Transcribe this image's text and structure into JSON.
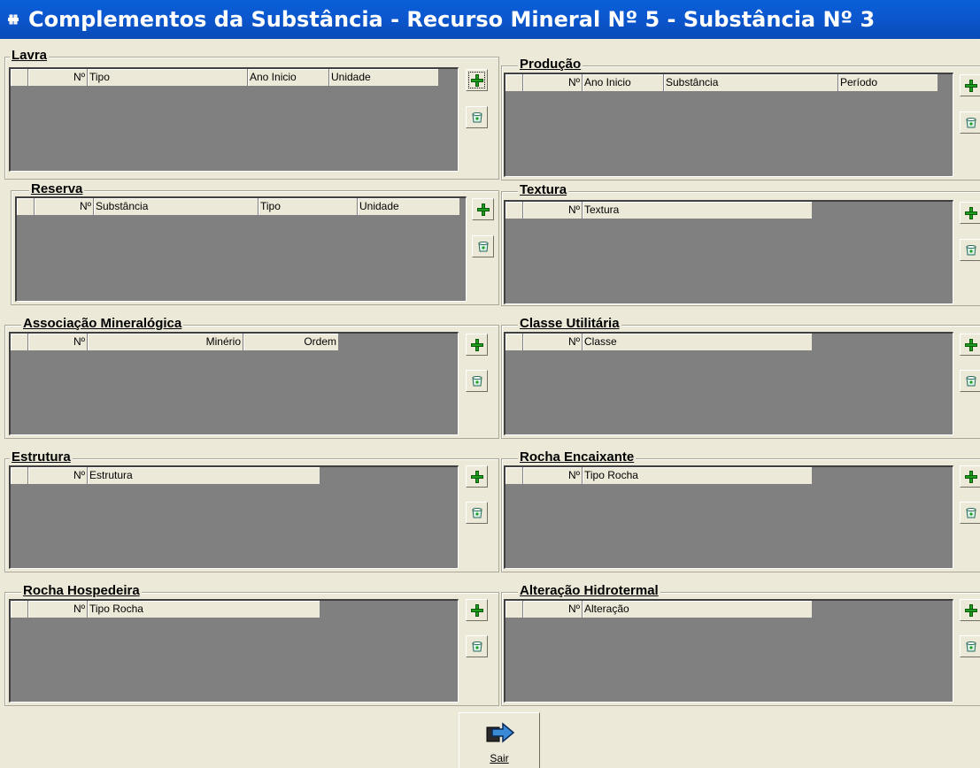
{
  "window": {
    "title": "Complementos da Substância - Recurso Mineral Nº 5 - Substância Nº 3"
  },
  "groups": {
    "lavra": {
      "title": "Lavra",
      "columns": [
        "",
        "Nº",
        "Tipo",
        "Ano Inicio",
        "Unidade"
      ]
    },
    "producao": {
      "title": "Produção",
      "columns": [
        "",
        "Nº",
        "Ano Inicio",
        "Substância",
        "Período"
      ]
    },
    "reserva": {
      "title": "Reserva",
      "columns": [
        "",
        "Nº",
        "Substância",
        "Tipo",
        "Unidade"
      ]
    },
    "textura": {
      "title": "Textura",
      "columns": [
        "",
        "Nº",
        "Textura"
      ]
    },
    "associacao": {
      "title": "Associação Mineralógica",
      "columns": [
        "",
        "Nº",
        "Minério",
        "Ordem"
      ]
    },
    "classe": {
      "title": "Classe Utilitária",
      "columns": [
        "",
        "Nº",
        "Classe"
      ]
    },
    "estrutura": {
      "title": "Estrutura",
      "columns": [
        "",
        "Nº",
        "Estrutura"
      ]
    },
    "rocha_encaixante": {
      "title": "Rocha Encaixante",
      "columns": [
        "",
        "Nº",
        "Tipo Rocha"
      ]
    },
    "rocha_hospedeira": {
      "title": "Rocha Hospedeira",
      "columns": [
        "",
        "Nº",
        "Tipo Rocha"
      ]
    },
    "alteracao": {
      "title": "Alteração Hidrotermal",
      "columns": [
        "",
        "Nº",
        "Alteração"
      ]
    }
  },
  "icons": {
    "add": "plus-icon",
    "delete": "bin-icon",
    "exit": "exit-arrow-icon",
    "title": "app-icon"
  },
  "colors": {
    "titlebar": "#0a5fd8",
    "grid_bg": "#808080",
    "face": "#ece9d8",
    "add_green": "#1e9e1e"
  },
  "footer": {
    "exit_label": "Sair"
  }
}
